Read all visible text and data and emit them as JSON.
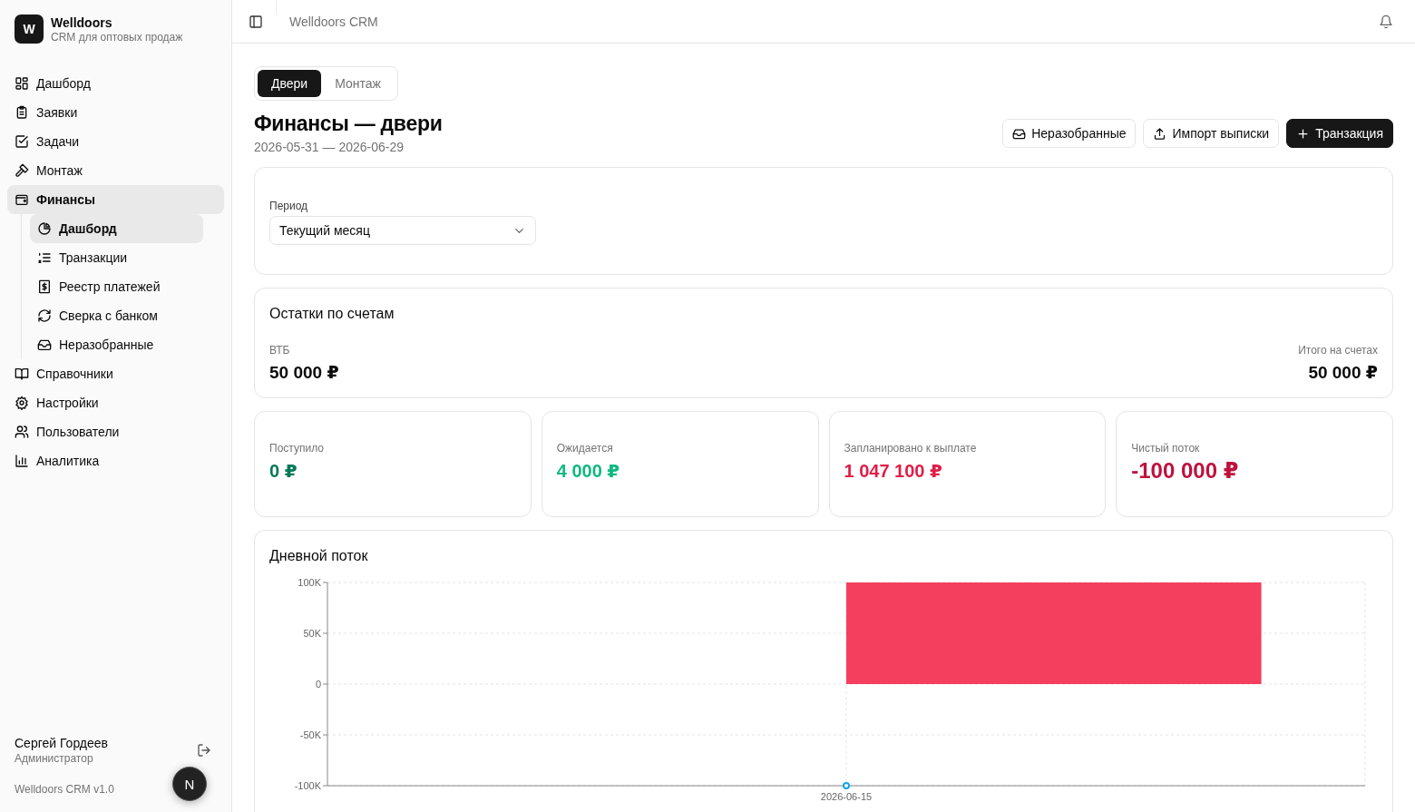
{
  "brand": {
    "logo": "W",
    "name": "Welldoors",
    "subtitle": "CRM для оптовых продаж"
  },
  "nav": [
    {
      "label": "Дашборд",
      "selected": false
    },
    {
      "label": "Заявки",
      "selected": false
    },
    {
      "label": "Задачи",
      "selected": false
    },
    {
      "label": "Монтаж",
      "selected": false
    },
    {
      "label": "Финансы",
      "selected": true,
      "children": [
        {
          "label": "Дашборд",
          "selected": true
        },
        {
          "label": "Транзакции",
          "selected": false
        },
        {
          "label": "Реестр платежей",
          "selected": false
        },
        {
          "label": "Сверка с банком",
          "selected": false
        },
        {
          "label": "Неразобранные",
          "selected": false
        }
      ]
    },
    {
      "label": "Справочники",
      "selected": false
    },
    {
      "label": "Настройки",
      "selected": false
    },
    {
      "label": "Пользователи",
      "selected": false
    },
    {
      "label": "Аналитика",
      "selected": false
    }
  ],
  "user": {
    "name": "Сергей Гордеев",
    "role": "Администратор",
    "version": "Welldoors CRM v1.0",
    "dev_badge": "N"
  },
  "header": {
    "title": "Welldoors CRM"
  },
  "tabs": [
    {
      "label": "Двери",
      "selected": true
    },
    {
      "label": "Монтаж",
      "selected": false
    }
  ],
  "page": {
    "title": "Финансы — двери",
    "range": "2026-05-31 — 2026-06-29"
  },
  "actions": [
    {
      "label": "Неразобранные",
      "kind": "outline"
    },
    {
      "label": "Импорт выписки",
      "kind": "outline"
    },
    {
      "label": "Транзакция",
      "kind": "primary"
    }
  ],
  "filter": {
    "label": "Период",
    "value": "Текущий месяц"
  },
  "balances": {
    "title": "Остатки по счетам",
    "accounts": [
      {
        "name": "ВТБ",
        "amount": "50 000 ₽"
      }
    ],
    "total_label": "Итого на счетах",
    "total": "50 000 ₽"
  },
  "stats": [
    {
      "label": "Поступило",
      "value": "0 ₽",
      "color": "#047857"
    },
    {
      "label": "Ожидается",
      "value": "4 000 ₽",
      "color": "#10b981"
    },
    {
      "label": "Запланировано к выплате",
      "value": "1 047 100 ₽",
      "color": "#e11d48"
    },
    {
      "label": "Чистый поток",
      "value": "-100 000 ₽",
      "color": "#be123c"
    }
  ],
  "daily": {
    "title": "Дневной поток",
    "chart_data": {
      "type": "bar",
      "categories": [
        "2026-06-15"
      ],
      "series": [
        {
          "color": "#f43f5e",
          "values": [
            100000
          ]
        }
      ],
      "grid": true,
      "ylim": [
        -100000,
        100000
      ],
      "yticks": [
        {
          "value": 100000,
          "label": "100K"
        },
        {
          "value": 50000,
          "label": "50K"
        },
        {
          "value": 0,
          "label": "0"
        },
        {
          "value": -50000,
          "label": "-50K"
        },
        {
          "value": -100000,
          "label": "-100K"
        }
      ]
    }
  }
}
